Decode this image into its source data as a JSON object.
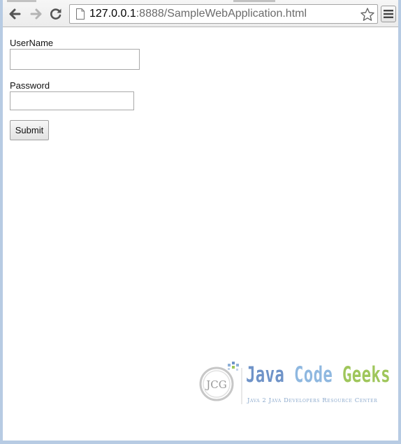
{
  "browser": {
    "url_host": "127.0.0.1",
    "url_path": ":8888/SampleWebApplication.html",
    "icons": {
      "back": "back-arrow-icon",
      "forward": "forward-arrow-icon",
      "reload": "reload-icon",
      "page": "page-icon",
      "bookmark": "star-icon",
      "menu": "hamburger-menu-icon"
    }
  },
  "form": {
    "username_label": "UserName",
    "username_value": "",
    "password_label": "Password",
    "password_value": "",
    "submit_label": "Submit"
  },
  "watermark": {
    "monogram": "JCG",
    "word_java": "Java",
    "word_code": "Code",
    "word_geeks": "Geeks",
    "tagline": "Java 2 Java Developers Resource Center",
    "colors": {
      "java": "#6f93c8",
      "code": "#8fb8e0",
      "geeks": "#9fc65b"
    }
  }
}
